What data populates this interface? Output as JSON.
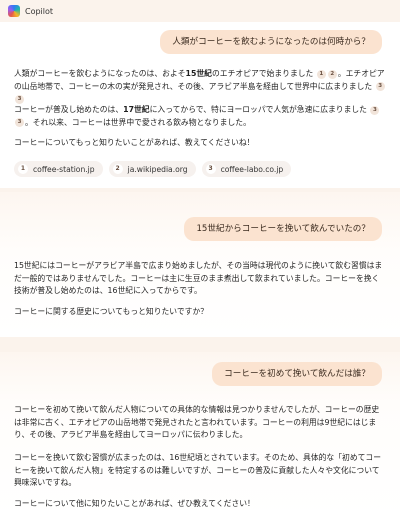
{
  "app": {
    "title": "Copilot"
  },
  "turns": [
    {
      "question": "人類がコーヒーを飲むようになったのは何時から？",
      "answer_p1": {
        "a": "人類がコーヒーを飲むようになったのは、およそ",
        "b": "15世紀",
        "c": "のエチオピアで始まりました",
        "d": "。エチオピアの山岳地帯で、コーヒーの木の実が発見され、その後、アラビア半島を経由して世界中に広まりました",
        "cites_1": [
          "1",
          "2"
        ],
        "cites_2": [
          "3",
          "3"
        ]
      },
      "answer_p2": {
        "a": "コーヒーが普及し始めたのは、",
        "b": "17世紀",
        "c": "に入ってからで、特にヨーロッパで人気が急速に広まりました",
        "d": "。それ以来、コーヒーは世界中で愛される飲み物となりました。",
        "cites": [
          "3",
          "3"
        ]
      },
      "answer_p3": "コーヒーについてもっと知りたいことがあれば、教えてくださいね！",
      "sources": [
        {
          "num": "1",
          "label": "coffee-station.jp"
        },
        {
          "num": "2",
          "label": "ja.wikipedia.org"
        },
        {
          "num": "3",
          "label": "coffee-labo.co.jp"
        }
      ]
    },
    {
      "question": "15世紀からコーヒーを挽いて飲んでいたの？",
      "answer_p1": "15世紀にはコーヒーがアラビア半島で広まり始めましたが、その当時は現代のように挽いて飲む習慣はまだ一般的ではありませんでした。コーヒーは主に生豆のまま煮出して飲まれていました。コーヒーを挽く技術が普及し始めたのは、16世紀に入ってからです。",
      "answer_p2": "コーヒーに関する歴史についてもっと知りたいですか？"
    },
    {
      "question": "コーヒーを初めて挽いて飲んだは誰？",
      "answer_p1": "コーヒーを初めて挽いて飲んだ人物についての具体的な情報は見つかりませんでしたが、コーヒーの歴史は非常に古く、エチオピアの山岳地帯で発見されたと言われています。コーヒーの利用は9世紀にはじまり、その後、アラビア半島を経由してヨーロッパに伝わりました。",
      "answer_p2": "コーヒーを挽いて飲む習慣が広まったのは、16世紀頃とされています。そのため、具体的な「初めてコーヒーを挽いて飲んだ人物」を特定するのは難しいですが、コーヒーの普及に貢献した人々や文化について興味深いですね。",
      "answer_p3": "コーヒーについて他に知りたいことがあれば、ぜひ教えてください！"
    }
  ],
  "colors": {
    "bubble_bg": "#fbe3d0",
    "chip_bg": "#f6f1ee",
    "page_bg": "#fbf3ec"
  }
}
